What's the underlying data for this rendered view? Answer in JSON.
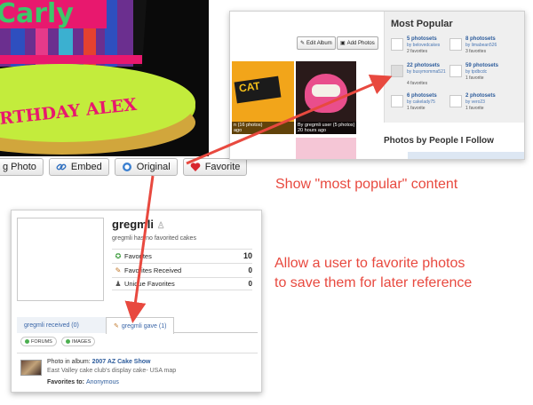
{
  "cake_photo": {
    "cake_text_top": "Carly",
    "cake_text_bottom": "RTHDAY ALEX"
  },
  "toolbar": {
    "buttons": [
      {
        "label": "g Photo",
        "icon": "none"
      },
      {
        "label": "Embed",
        "icon": "link-icon"
      },
      {
        "label": "Original",
        "icon": "magnifier-icon"
      },
      {
        "label": "Favorite",
        "icon": "heart-icon"
      }
    ]
  },
  "popular_panel": {
    "edit_album_label": "Edit Album",
    "add_photos_label": "Add Photos",
    "thumb_caption_1": "n (16 photos)",
    "thumb_caption_1b": "ago",
    "thumb_caption_2": "By gregmli user (5 photos)",
    "thumb_caption_2b": "20 hours ago",
    "thumb_cat_text": "CAT",
    "most_popular_title": "Most Popular",
    "items": [
      {
        "count": "5 photosets",
        "by": "by belovedcakes",
        "favs": "2 favorites"
      },
      {
        "count": "8 photosets",
        "by": "by limabean526",
        "favs": "3 favorites"
      },
      {
        "count": "22 photosets",
        "by": "by busymomma521",
        "favs": "4 favorites"
      },
      {
        "count": "59 photosets",
        "by": "by tpdbcdc",
        "favs": "1 favorite"
      },
      {
        "count": "6 photosets",
        "by": "by cakelady75",
        "favs": "1 favorite"
      },
      {
        "count": "2 photosets",
        "by": "by vero23",
        "favs": "1 favorite"
      }
    ],
    "people_follow_title": "Photos by People I Follow"
  },
  "caption_popular": "Show \"most popular\" content",
  "caption_favorite_line1": "Allow a user to favorite photos",
  "caption_favorite_line2": "to save them for later reference",
  "profile": {
    "username": "gregmli",
    "subtitle": "gregmli has no favorited cakes",
    "stats": [
      {
        "label": "Favorites",
        "value": "10",
        "icon": "ribbon-icon"
      },
      {
        "label": "Favorites Received",
        "value": "0",
        "icon": "pencil-icon"
      },
      {
        "label": "Unique Favorites",
        "value": "0",
        "icon": "person-icon"
      }
    ],
    "tab_received": "gregmli received (0)",
    "tab_gave": "gregmli gave (1)",
    "pill_forums": "FORUMS",
    "pill_images": "IMAGES",
    "item_prefix": "Photo in album: ",
    "item_album": "2007 AZ Cake Show",
    "item_desc": "East Valley cake club's display cake- USA map",
    "favorites_to_label": "Favorites to: ",
    "favorites_to_value": "Anonymous"
  },
  "colors": {
    "annotation": "#e8493f",
    "link": "#2d5c9c"
  }
}
